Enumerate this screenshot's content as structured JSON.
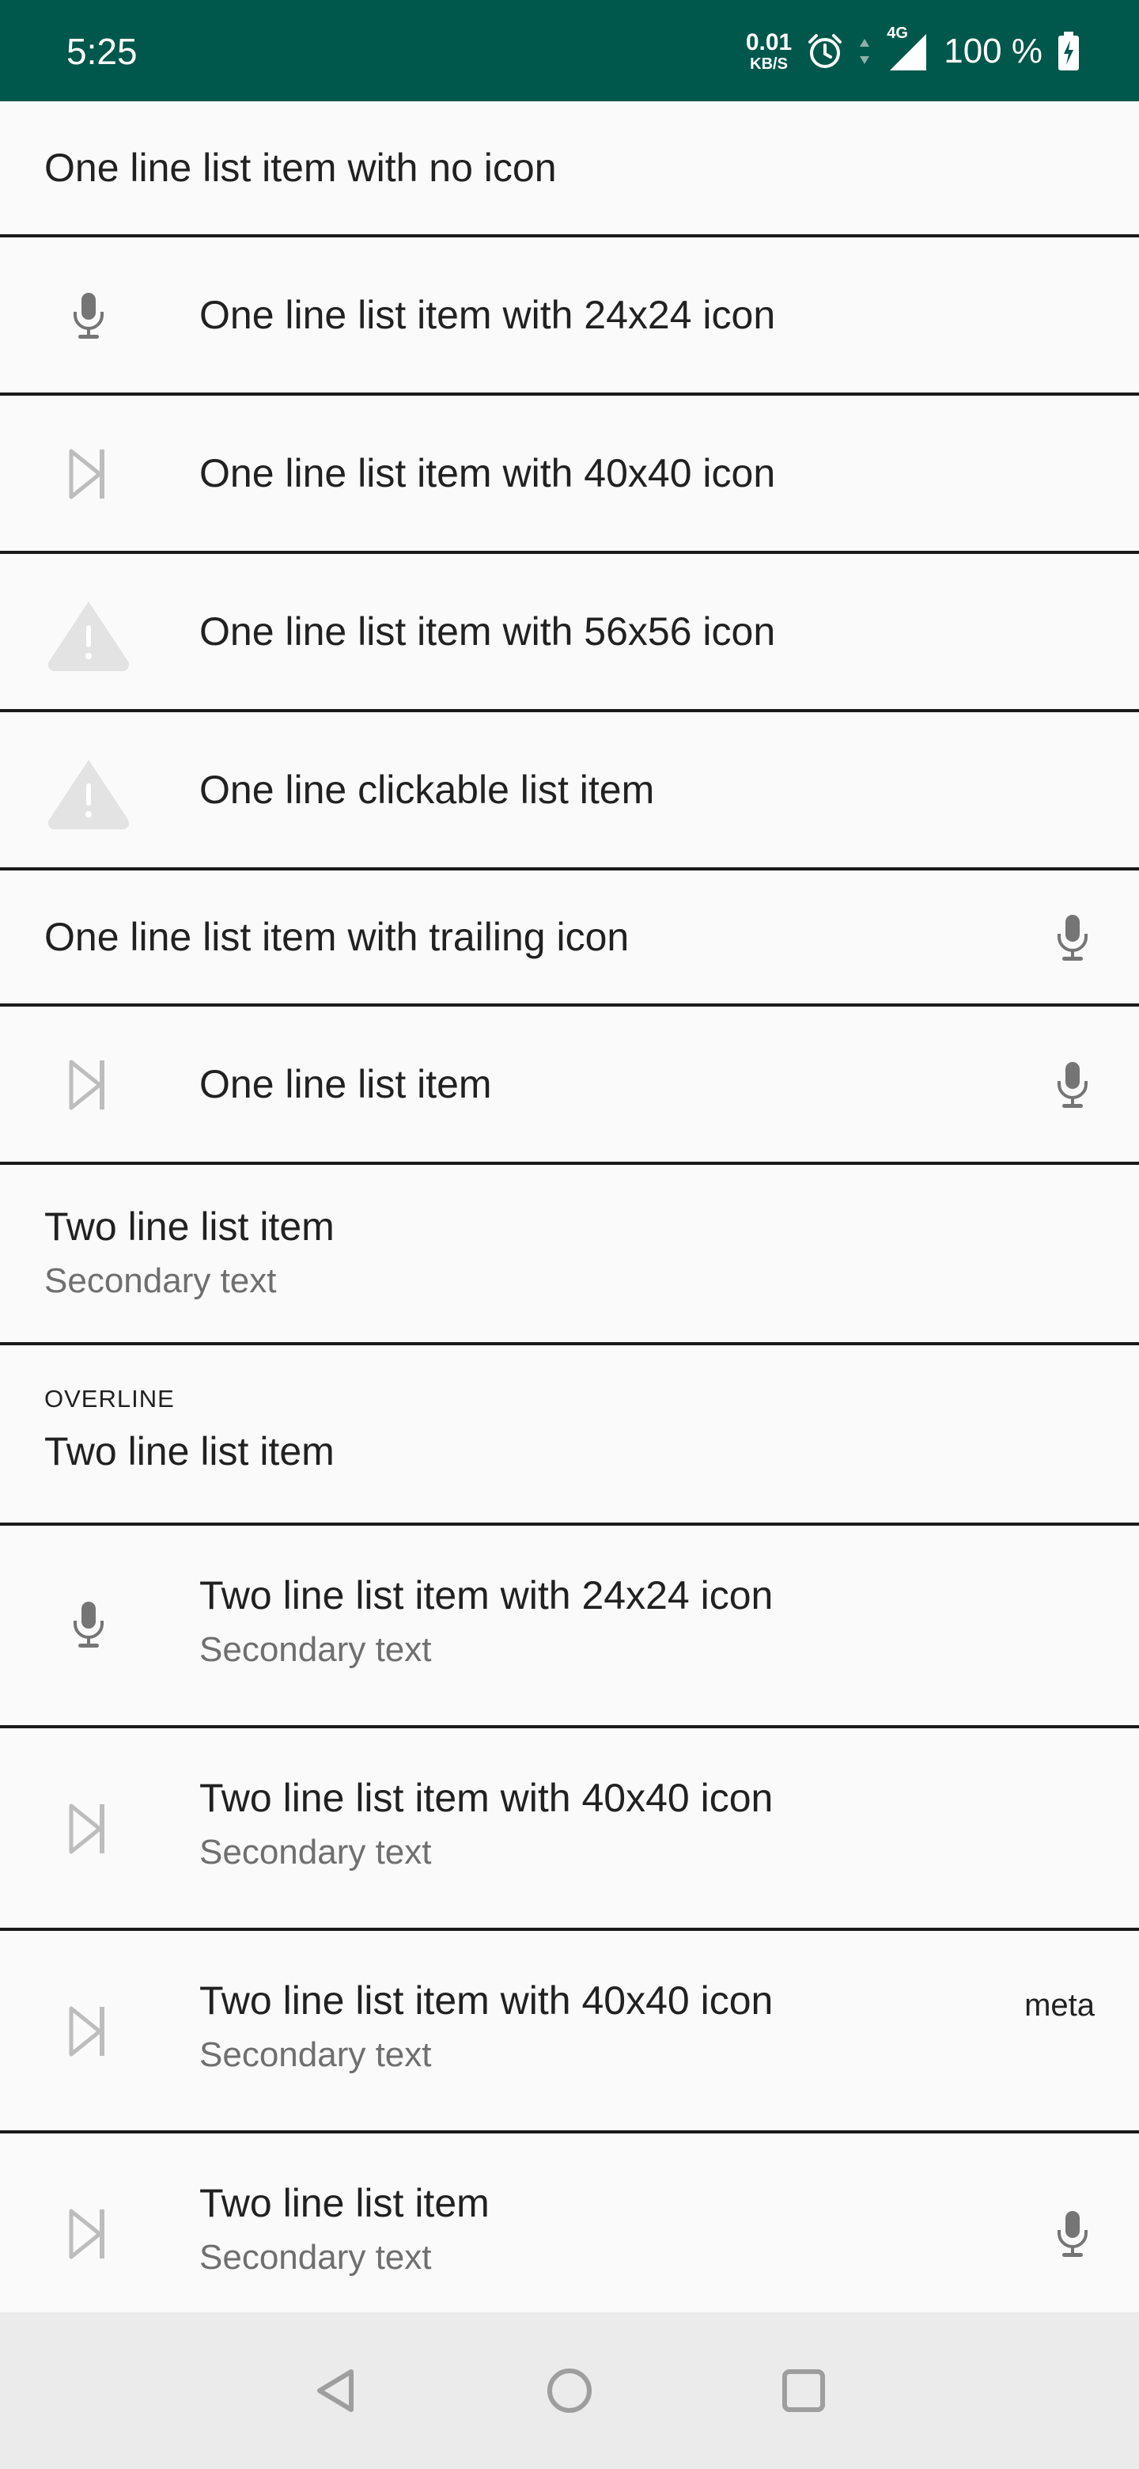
{
  "status_bar": {
    "time": "5:25",
    "net_speed_value": "0.01",
    "net_speed_unit": "KB/S",
    "network_type": "4G",
    "battery": "100 %",
    "icons": [
      "alarm-icon",
      "data-arrows-icon",
      "signal-icon",
      "battery-charging-icon"
    ]
  },
  "list": {
    "items": [
      {
        "primary": "One line list item with no icon"
      },
      {
        "primary": "One line list item with 24x24 icon",
        "leading_icon": "mic-icon"
      },
      {
        "primary": "One line list item with 40x40 icon",
        "leading_icon": "skip-next-icon"
      },
      {
        "primary": "One line list item with 56x56 icon",
        "leading_icon": "warning-icon"
      },
      {
        "primary": "One line clickable list item",
        "leading_icon": "warning-icon"
      },
      {
        "primary": "One line list item with trailing icon",
        "trailing_icon": "mic-icon"
      },
      {
        "primary": "One line list item",
        "leading_icon": "skip-next-icon",
        "trailing_icon": "mic-icon"
      },
      {
        "primary": "Two line list item",
        "secondary": "Secondary text"
      },
      {
        "overline": "OVERLINE",
        "primary": "Two line list item"
      },
      {
        "primary": "Two line list item with 24x24 icon",
        "secondary": "Secondary text",
        "leading_icon": "mic-icon"
      },
      {
        "primary": "Two line list item with 40x40 icon",
        "secondary": "Secondary text",
        "leading_icon": "skip-next-icon"
      },
      {
        "primary": "Two line list item with 40x40 icon",
        "secondary": "Secondary text",
        "leading_icon": "skip-next-icon",
        "meta": "meta"
      },
      {
        "primary": "Two line list item",
        "secondary": "Secondary text",
        "leading_icon": "skip-next-icon",
        "trailing_icon": "mic-icon"
      }
    ]
  },
  "nav_bar": {
    "icons": [
      "back-icon",
      "home-icon",
      "recents-icon"
    ]
  },
  "colors": {
    "status_bar": "#00574b",
    "background": "#fafafa",
    "divider": "#1a1a1a",
    "icon": "#757575",
    "nav_bar": "#ebebeb"
  }
}
